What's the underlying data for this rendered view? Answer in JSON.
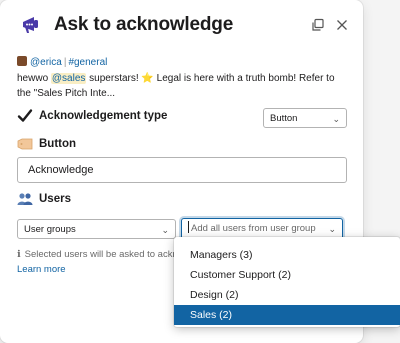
{
  "modal": {
    "title": "Ask to acknowledge",
    "icons": {
      "app": "megaphone-app-icon",
      "copy": "copy-window-icon",
      "close": "close-icon"
    }
  },
  "message": {
    "author": "@erica",
    "separator": "|",
    "channel": "#general",
    "text_pre": "hewwo ",
    "mention": "@sales",
    "text_post": " superstars! ⭐ Legal is here with a truth bomb! Refer to the \"Sales Pitch Inte..."
  },
  "ack_type": {
    "label": "Acknowledgement type",
    "icon": "checkmark-icon",
    "selected": "Button"
  },
  "button_section": {
    "label": "Button",
    "icon": "label-tag-icon",
    "value": "Acknowledge"
  },
  "users_section": {
    "label": "Users",
    "icon": "users-icon",
    "group_selected": "User groups",
    "users_placeholder": "Add all users from user group",
    "hint": "Selected users will be asked to ackno",
    "learn_more": "Learn more"
  },
  "dropdown": {
    "options": [
      {
        "label": "Managers (3)",
        "selected": false
      },
      {
        "label": "Customer Support (2)",
        "selected": false
      },
      {
        "label": "Design (2)",
        "selected": false
      },
      {
        "label": "Sales (2)",
        "selected": true
      }
    ]
  },
  "colors": {
    "accent": "#1264a3",
    "mention_bg": "#f9eec4",
    "app_purple": "#4a3aa8"
  }
}
